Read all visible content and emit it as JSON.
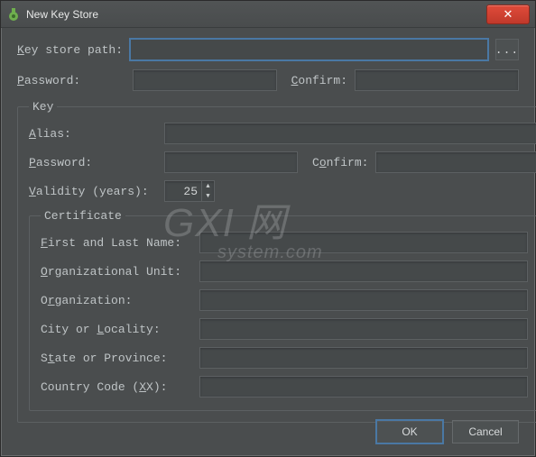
{
  "window": {
    "title": "New Key Store",
    "close_glyph": "✕"
  },
  "form": {
    "key_store_path_label": "Key store path:",
    "key_store_path": "",
    "browse_label": "...",
    "password_label": "Password:",
    "password": "",
    "confirm_label": "Confirm:",
    "confirm": ""
  },
  "key": {
    "legend": "Key",
    "alias_label": "Alias:",
    "alias": "",
    "password_label": "Password:",
    "password": "",
    "confirm_label": "Confirm:",
    "confirm": "",
    "validity_label": "Validity (years):",
    "validity": "25"
  },
  "certificate": {
    "legend": "Certificate",
    "first_last_label": "First and Last Name:",
    "first_last": "",
    "org_unit_label": "Organizational Unit:",
    "org_unit": "",
    "org_label": "Organization:",
    "org": "",
    "city_label": "City or Locality:",
    "city": "",
    "state_label": "State or Province:",
    "state": "",
    "country_label": "Country Code (XX):",
    "country": ""
  },
  "buttons": {
    "ok": "OK",
    "cancel": "Cancel"
  },
  "watermark": {
    "line1": "GXI 网",
    "line2": "system.com"
  }
}
